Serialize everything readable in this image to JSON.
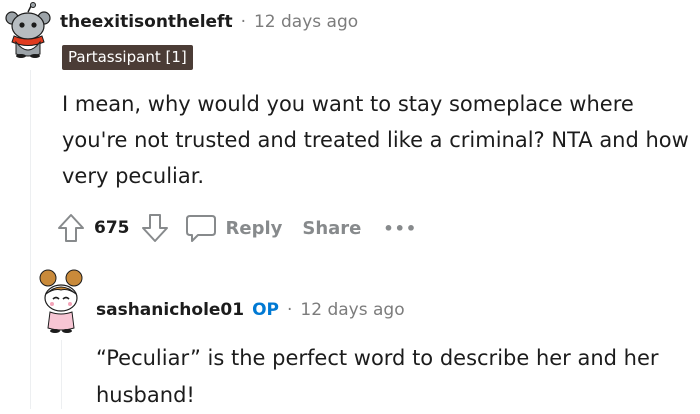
{
  "comment": {
    "author": "theexitisontheleft",
    "separator": "·",
    "time": "12 days ago",
    "flair": "Partassipant [1]",
    "body": "I mean, why would you want to stay someplace where you're not trusted and treated like a criminal? NTA and how very peculiar.",
    "votes": "675",
    "reply_label": "Reply",
    "share_label": "Share",
    "more_label": "•••"
  },
  "reply": {
    "author": "sashanichole01",
    "op_badge": "OP",
    "separator": "·",
    "time": "12 days ago",
    "body": "“Peculiar” is the perfect word to describe her and her husband!"
  },
  "colors": {
    "flair_bg": "#4b3c36",
    "op_blue": "#0079d3",
    "muted": "#878a8c",
    "avatar1_body": "#9ca3a8",
    "avatar1_scarf": "#e03b1f",
    "avatar2_hair": "#c98a3a"
  },
  "icons": {
    "avatar1": "snoo-avatar-icon",
    "avatar2": "snoo-avatar-icon",
    "upvote": "upvote-arrow-icon",
    "downvote": "downvote-arrow-icon",
    "reply": "comment-bubble-icon",
    "more": "more-dots-icon"
  }
}
